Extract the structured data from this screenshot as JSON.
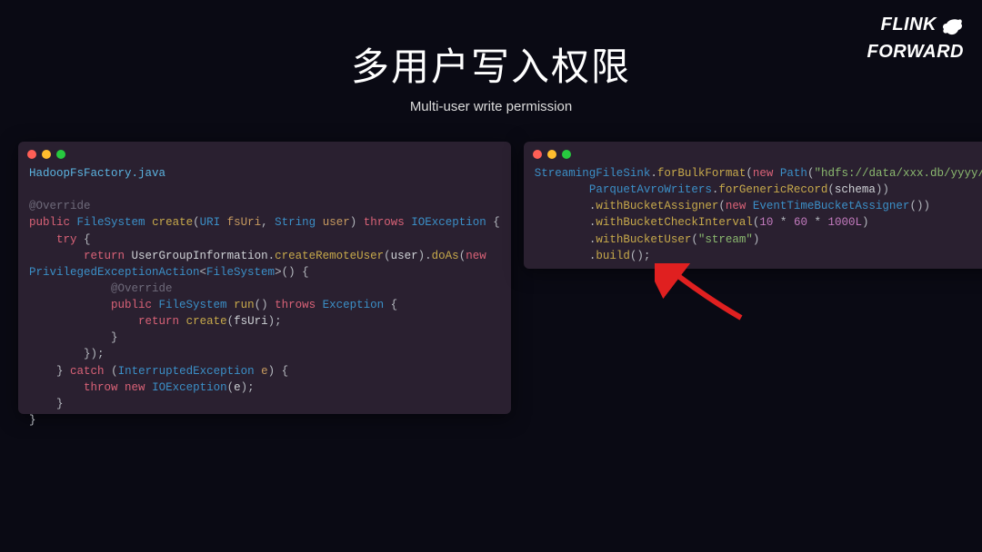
{
  "logo": {
    "line1": "FLINK",
    "line2": "FORWARD"
  },
  "title": {
    "main": "多用户写入权限",
    "sub": "Multi-user write permission"
  },
  "left": {
    "filename": "HadoopFsFactory.java",
    "code": {
      "override": "@Override",
      "public": "public",
      "FileSystem": "FileSystem",
      "create": "create",
      "URI": "URI",
      "fsUri": "fsUri",
      "String": "String",
      "user": "user",
      "throws": "throws",
      "IOException": "IOException",
      "try": "try",
      "return": "return",
      "UserGroupInformation": "UserGroupInformation",
      "createRemoteUser": "createRemoteUser",
      "doAs": "doAs",
      "new": "new",
      "PrivilegedExceptionAction": "PrivilegedExceptionAction",
      "run": "run",
      "Exception": "Exception",
      "createCall": "create",
      "catch": "catch",
      "InterruptedException": "InterruptedException",
      "e": "e",
      "throw": "throw"
    }
  },
  "right": {
    "code": {
      "StreamingFileSink": "StreamingFileSink",
      "forBulkFormat": "forBulkFormat",
      "new": "new",
      "Path": "Path",
      "pathStr": "\"hdfs://data/xxx.db/yyyy/\"",
      "ParquetAvroWriters": "ParquetAvroWriters",
      "forGenericRecord": "forGenericRecord",
      "schema": "schema",
      "withBucketAssigner": "withBucketAssigner",
      "EventTimeBucketAssigner": "EventTimeBucketAssigner",
      "withBucketCheckInterval": "withBucketCheckInterval",
      "ten": "10",
      "sixty": "60",
      "thousand": "1000L",
      "withBucketUser": "withBucketUser",
      "streamStr": "\"stream\"",
      "build": "build"
    }
  }
}
